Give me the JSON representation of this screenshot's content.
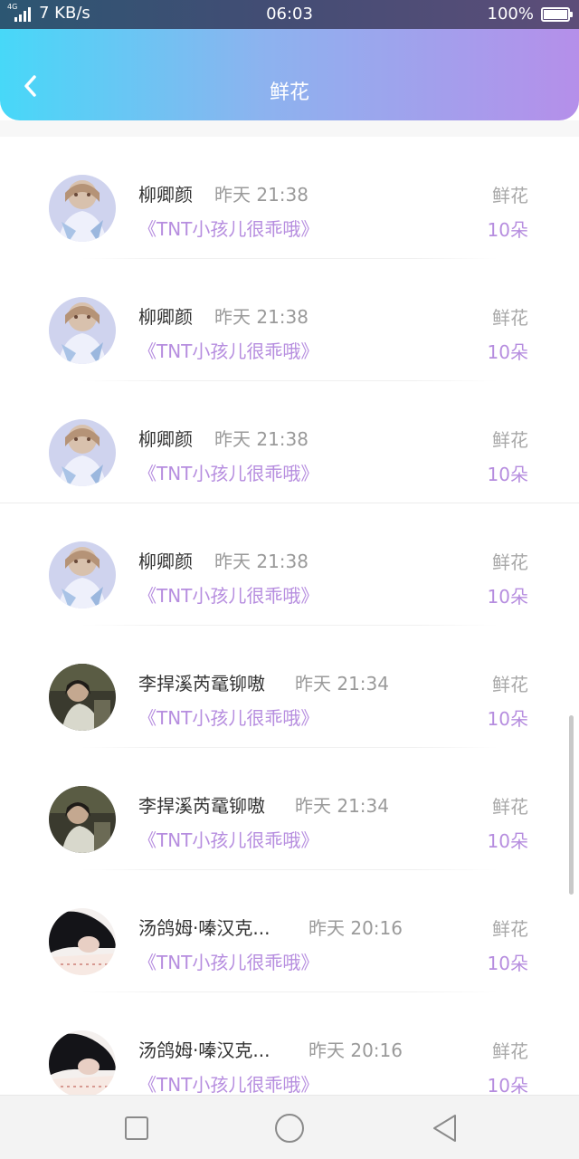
{
  "status_bar": {
    "network": "4G",
    "speed": "7 KB/s",
    "time": "06:03",
    "battery": "100%"
  },
  "header": {
    "title": "鲜花",
    "back_icon": "chevron-left-icon"
  },
  "rows": [
    {
      "name": "柳卿颜",
      "time": "昨天 21:38",
      "song": "《TNT小孩儿很乖哦》",
      "gift_type": "鲜花",
      "gift_count": "10朵",
      "avatar": "avatar-a"
    },
    {
      "name": "柳卿颜",
      "time": "昨天 21:38",
      "song": "《TNT小孩儿很乖哦》",
      "gift_type": "鲜花",
      "gift_count": "10朵",
      "avatar": "avatar-a"
    },
    {
      "name": "柳卿颜",
      "time": "昨天 21:38",
      "song": "《TNT小孩儿很乖哦》",
      "gift_type": "鲜花",
      "gift_count": "10朵",
      "avatar": "avatar-a"
    },
    {
      "name": "柳卿颜",
      "time": "昨天 21:38",
      "song": "《TNT小孩儿很乖哦》",
      "gift_type": "鲜花",
      "gift_count": "10朵",
      "avatar": "avatar-a"
    },
    {
      "name": "李捍溪芮鼋铆嗷",
      "time": "昨天 21:34",
      "song": "《TNT小孩儿很乖哦》",
      "gift_type": "鲜花",
      "gift_count": "10朵",
      "avatar": "avatar-b"
    },
    {
      "name": "李捍溪芮鼋铆嗷",
      "time": "昨天 21:34",
      "song": "《TNT小孩儿很乖哦》",
      "gift_type": "鲜花",
      "gift_count": "10朵",
      "avatar": "avatar-b"
    },
    {
      "name": "汤鸽姆·嗪汉克...",
      "time": "昨天 20:16",
      "song": "《TNT小孩儿很乖哦》",
      "gift_type": "鲜花",
      "gift_count": "10朵",
      "avatar": "avatar-c"
    },
    {
      "name": "汤鸽姆·嗪汉克...",
      "time": "昨天 20:16",
      "song": "《TNT小孩儿很乖哦》",
      "gift_type": "鲜花",
      "gift_count": "10朵",
      "avatar": "avatar-c"
    }
  ],
  "nav_bar": {
    "recents_icon": "square-icon",
    "home_icon": "circle-icon",
    "back_icon": "triangle-back-icon"
  },
  "colors": {
    "header_gradient_start": "#47d8f8",
    "header_gradient_end": "#b58fea",
    "accent_purple": "#b68ddf",
    "name_text": "#333333",
    "muted_text": "#9a9a9a"
  }
}
